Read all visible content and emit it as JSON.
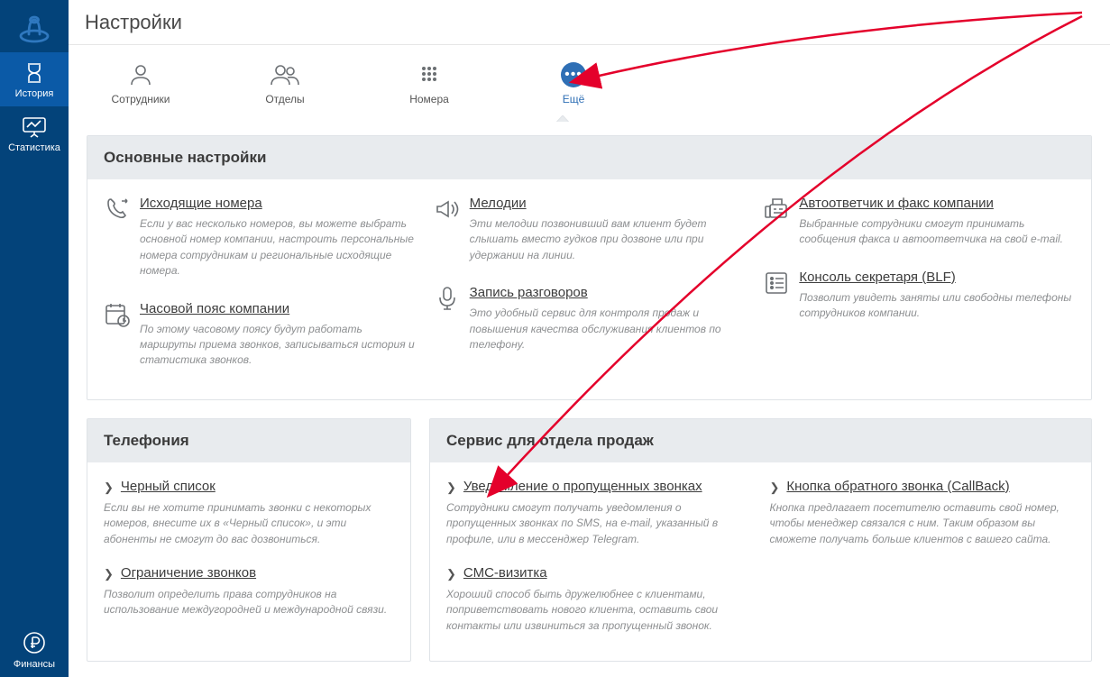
{
  "page_title": "Настройки",
  "sidebar": {
    "items": [
      {
        "label": "История"
      },
      {
        "label": "Статистика"
      },
      {
        "label": "Финансы"
      }
    ]
  },
  "tabs": [
    {
      "label": "Сотрудники"
    },
    {
      "label": "Отделы"
    },
    {
      "label": "Номера"
    },
    {
      "label": "Ещё"
    }
  ],
  "main_panel": {
    "title": "Основные настройки",
    "items": [
      {
        "title": "Исходящие номера",
        "desc": "Если у вас несколько номеров, вы можете выбрать основной номер компании, настроить персональные номера сотрудникам и региональные исходящие номера."
      },
      {
        "title": "Мелодии",
        "desc": "Эти мелодии позвонивший вам клиент будет слышать вместо гудков при дозвоне или при удержании на линии."
      },
      {
        "title": "Автоответчик и факс компании",
        "desc": "Выбранные сотрудники смогут принимать сообщения факса и автоответчика на свой e-mail."
      },
      {
        "title": "Часовой пояс компании",
        "desc": "По этому часовому поясу будут работать маршруты приема звонков, записываться история и статистика звонков."
      },
      {
        "title": "Запись разговоров",
        "desc": "Это удобный сервис для контроля продаж и повышения качества обслуживания клиентов по телефону."
      },
      {
        "title": "Консоль секретаря (BLF)",
        "desc": "Позволит увидеть заняты или свободны телефоны сотрудников компании."
      }
    ]
  },
  "tel_panel": {
    "title": "Телефония",
    "items": [
      {
        "title": "Черный список",
        "desc": "Если вы не хотите принимать звонки с некоторых номеров, внесите их в «Черный список», и эти абоненты не смогут до вас дозвониться."
      },
      {
        "title": "Ограничение звонков",
        "desc": "Позволит определить права сотрудников на использование междугородней и международной связи."
      }
    ]
  },
  "sales_panel": {
    "title": "Сервис для отдела продаж",
    "col1": [
      {
        "title": "Уведомление о пропущенных звонках",
        "desc": "Сотрудники смогут получать уведомления о пропущенных звонках по SMS, на e-mail, указанный в профиле, или в мессенджер Telegram."
      },
      {
        "title": "СМС-визитка",
        "desc": "Хороший способ быть дружелюбнее с клиентами, поприветствовать нового клиента, оставить свои контакты или извиниться за пропущенный звонок."
      }
    ],
    "col2": [
      {
        "title": "Кнопка обратного звонка (CallBack)",
        "desc": "Кнопка предлагает посетителю оставить свой номер, чтобы менеджер связался с ним. Таким образом вы сможете получать больше клиентов с вашего сайта."
      }
    ]
  }
}
